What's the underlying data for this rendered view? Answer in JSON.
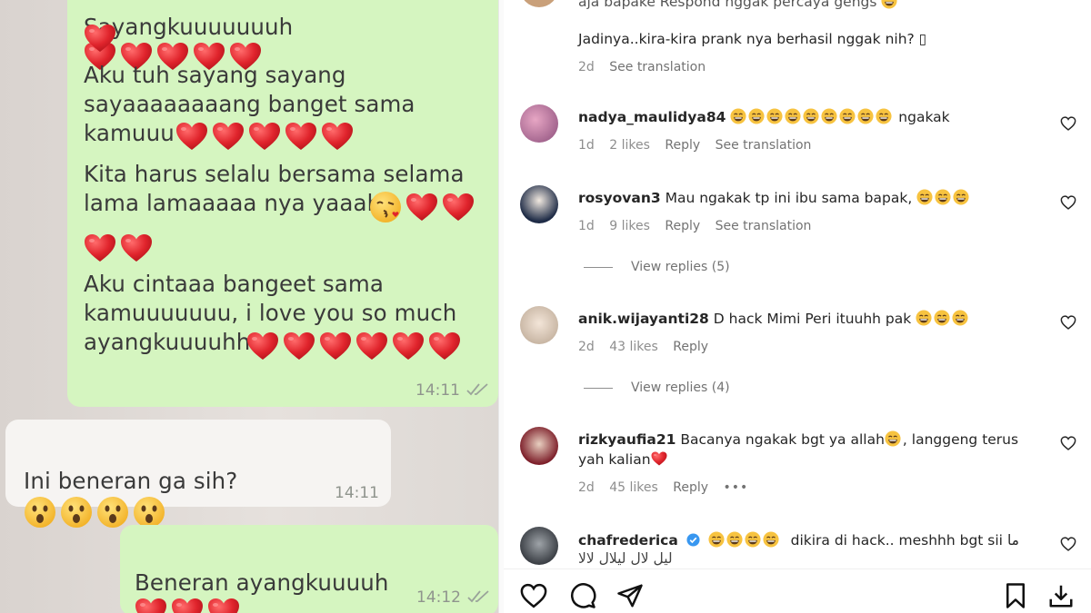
{
  "chat": {
    "messages": [
      {
        "id": "m1",
        "side": "out",
        "text_top": "Sayangkuuuuuuuh",
        "text_2": "Aku tuh sayang sayang\nsayaaaaaaaang banget sama\nkamuuu",
        "text_3": "Kita harus selalu bersama selama\nlama lamaaaaa nya yaaah",
        "text_4": "Aku cintaaa bangeet sama\nkamuuuuuuu, i love you so much\nayangkuuuuhh",
        "time": "14:11"
      },
      {
        "id": "m2",
        "side": "in",
        "text": "Ini beneran ga sih?",
        "time": "14:11"
      },
      {
        "id": "m3",
        "side": "out",
        "text": "Beneran ayangkuuuuh",
        "time": "14:12"
      }
    ]
  },
  "comments": {
    "top_partial": {
      "text_cut": "aja bapake Respond nggak percaya gengs",
      "text": "Jadinya..kira-kira prank nya berhasil nggak nih? ▯",
      "time": "2d",
      "see_translation": "See translation"
    },
    "items": [
      {
        "user": "nadya_maulidya84",
        "text": "ngakak",
        "time": "1d",
        "likes": "2 likes",
        "reply": "Reply",
        "translation": "See translation"
      },
      {
        "user": "rosyovan3",
        "text": "Mau ngakak tp ini ibu sama bapak,",
        "time": "1d",
        "likes": "9 likes",
        "reply": "Reply",
        "translation": "See translation",
        "view_replies": "View replies (5)"
      },
      {
        "user": "anik.wijayanti28",
        "text": "D hack Mimi Peri ituuhh pak",
        "time": "2d",
        "likes": "43 likes",
        "reply": "Reply",
        "view_replies": "View replies (4)"
      },
      {
        "user": "rizkyaufia21",
        "text": "Bacanya ngakak bgt ya allah",
        "text_b": ", langgeng terus",
        "text_2": "yah kalian",
        "time": "2d",
        "likes": "45 likes",
        "reply": "Reply",
        "more": "•••"
      },
      {
        "user": "chafrederica",
        "text": "dikira di hack.. meshhh bgt sii",
        "text_rtl": "ما",
        "text_2_cut": "ليل لال ليلال لالا"
      }
    ]
  },
  "actionbar": {
    "icons": [
      "heart-icon",
      "comment-icon",
      "share-icon",
      "bookmark-icon",
      "download-icon"
    ]
  },
  "colors": {
    "bubble_out": "#d5f5c0",
    "bubble_in": "#f6f4f2",
    "heart_red": "#e0242c",
    "ig_meta": "#8e8e8e",
    "verified_blue": "#3897f0"
  }
}
